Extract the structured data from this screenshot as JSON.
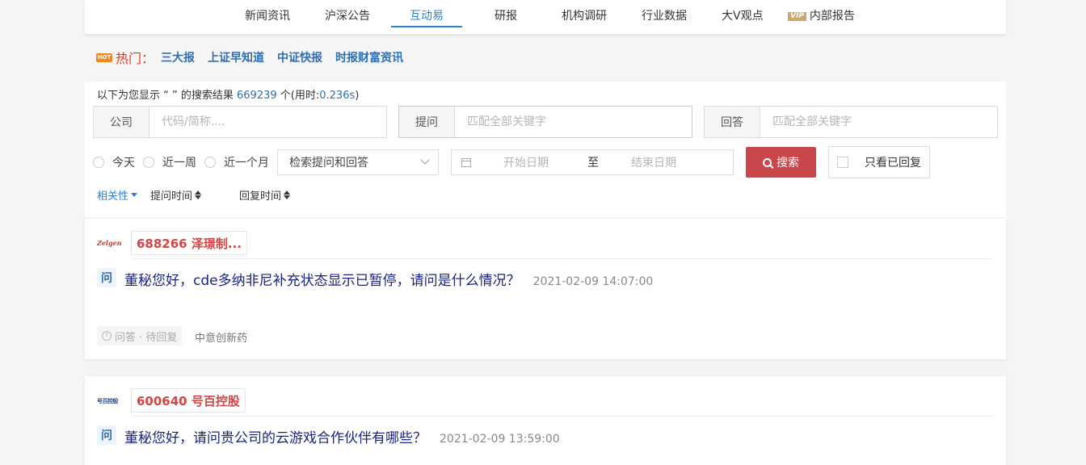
{
  "nav": {
    "items": [
      "新闻资讯",
      "沪深公告",
      "互动易",
      "研报",
      "机构调研",
      "行业数据",
      "大V观点",
      "内部报告"
    ],
    "active": "互动易",
    "vip_badge": "VIP"
  },
  "hot": {
    "icon_text": "HOT",
    "label": "热门：",
    "links": [
      "三大报",
      "上证早知道",
      "中证快报",
      "时报财富资讯"
    ]
  },
  "search": {
    "summary_prefix": "以下为您显示 “ ” 的搜索结果",
    "result_count": "669239",
    "summary_mid": "个(用时:",
    "elapsed": "0.236s",
    "summary_suffix": ")",
    "company_label": "公司",
    "company_placeholder": "代码/简称....",
    "question_label": "提问",
    "question_placeholder": "匹配全部关键字",
    "answer_label": "回答",
    "answer_placeholder": "匹配全部关键字",
    "ranges": [
      "今天",
      "近一周",
      "近一个月"
    ],
    "scope_select": "检索提问和回答",
    "start_date_placeholder": "开始日期",
    "date_to": "至",
    "end_date_placeholder": "结束日期",
    "search_button": "搜索",
    "only_replied": "只看已回复"
  },
  "sort": {
    "relevance": "相关性",
    "question_time": "提问时间",
    "reply_time": "回复时间"
  },
  "results": [
    {
      "logo": "Zelgen",
      "stock": "688266 泽璟制...",
      "q_badge": "问",
      "question": "董秘您好，cde多纳非尼补充状态显示已暂停，请问是什么情况？",
      "time": "2021-02-09 14:07:00",
      "status": "问答 · 待回复",
      "tag": "中意创新药"
    },
    {
      "logo": "号百控股",
      "stock": "600640 号百控股",
      "q_badge": "问",
      "question": "董秘您好，请问贵公司的云游戏合作伙伴有哪些？",
      "time": "2021-02-09 13:59:00"
    }
  ]
}
